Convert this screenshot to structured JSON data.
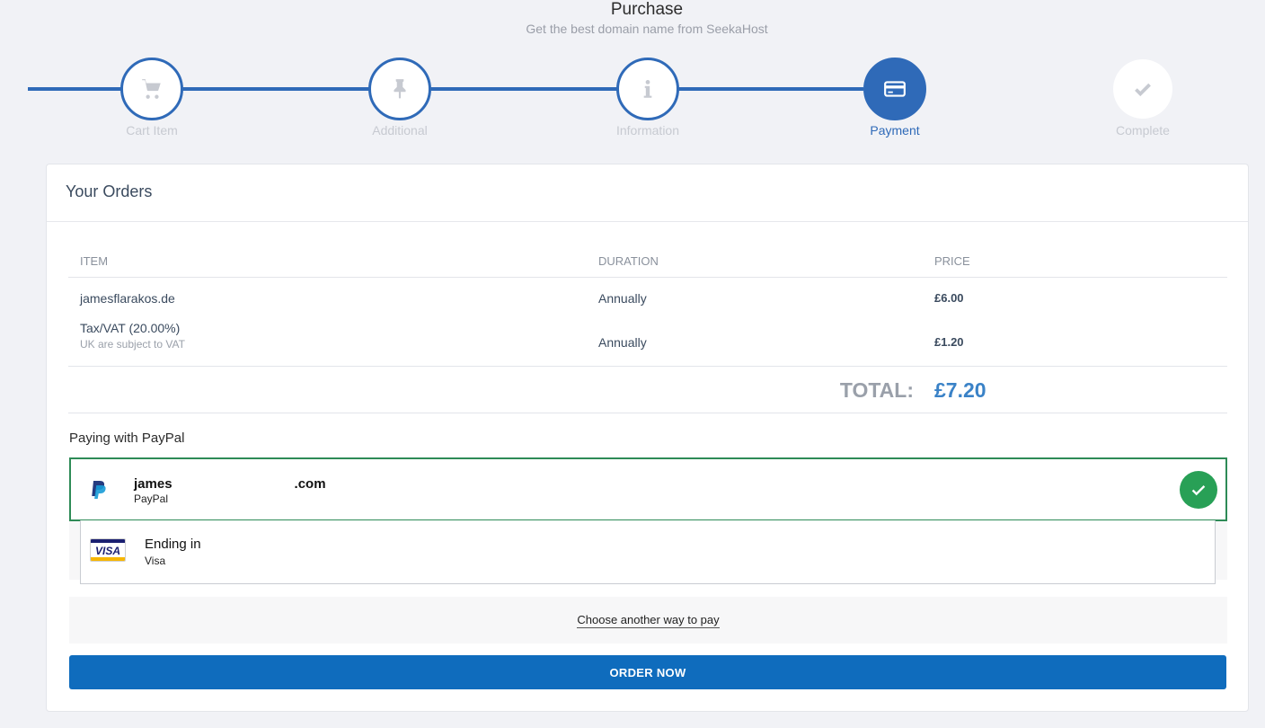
{
  "header": {
    "title": "Purchase",
    "subtitle": "Get the best domain name from SeekaHost"
  },
  "steps": [
    {
      "label": "Cart Item",
      "icon": "cart-icon",
      "state": "done"
    },
    {
      "label": "Additional",
      "icon": "pin-icon",
      "state": "done"
    },
    {
      "label": "Information",
      "icon": "info-icon",
      "state": "done"
    },
    {
      "label": "Payment",
      "icon": "credit-card-icon",
      "state": "active"
    },
    {
      "label": "Complete",
      "icon": "check-icon",
      "state": "pending"
    }
  ],
  "orders": {
    "title": "Your Orders",
    "columns": {
      "item": "ITEM",
      "duration": "DURATION",
      "price": "PRICE"
    },
    "rows": [
      {
        "item": "jamesflarakos.de",
        "note": "",
        "duration": "Annually",
        "price": "£6.00"
      },
      {
        "item": "Tax/VAT (20.00%)",
        "note": "UK are subject to VAT",
        "duration": "Annually",
        "price": "£1.20"
      }
    ],
    "total_label": "TOTAL:",
    "total_value": "£7.20"
  },
  "payment": {
    "heading": "Paying with PayPal",
    "methods": [
      {
        "email_start": "james",
        "email_end": ".com",
        "kind": "PayPal",
        "selected": true,
        "icon": "paypal-icon"
      },
      {
        "label": "Ending in",
        "kind": "Visa",
        "selected": false,
        "icon": "visa-card-icon"
      }
    ],
    "another_way": "Choose another way to pay",
    "order_button": "ORDER NOW"
  },
  "colors": {
    "accent": "#2f6ab8",
    "total": "#3a82c7",
    "selected_border": "#2e8b57",
    "order_button": "#0f6cbd"
  }
}
